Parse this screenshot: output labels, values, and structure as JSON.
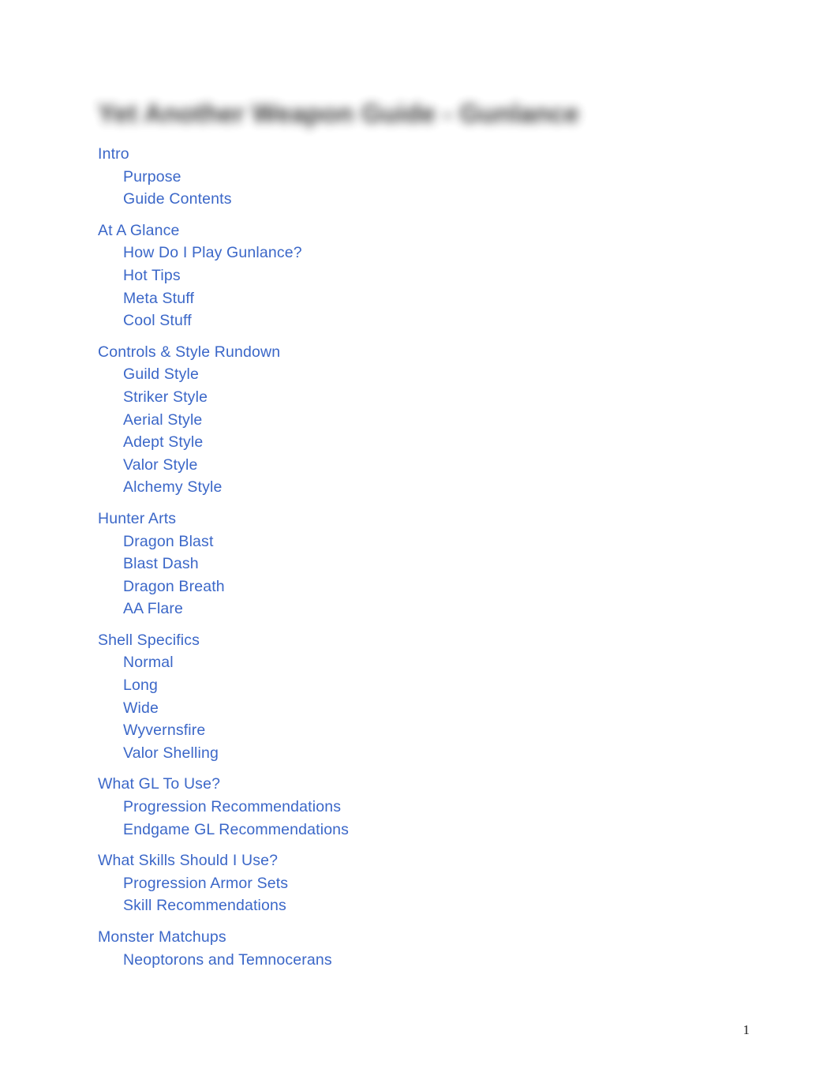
{
  "document": {
    "title": "Yet Another Weapon Guide - Gunlance",
    "title_redacted": true,
    "page_number": "1",
    "link_color": "#3b67c8",
    "background_color": "#ffffff",
    "title_color": "#2b2b2b"
  },
  "toc": {
    "sections": [
      {
        "heading": "Intro",
        "items": [
          "Purpose",
          "Guide Contents"
        ]
      },
      {
        "heading": "At A Glance",
        "items": [
          "How Do I Play Gunlance?",
          "Hot Tips",
          "Meta Stuff",
          "Cool Stuff"
        ]
      },
      {
        "heading": "Controls & Style Rundown",
        "items": [
          "Guild Style",
          "Striker Style",
          "Aerial Style",
          "Adept Style",
          "Valor Style",
          "Alchemy Style"
        ]
      },
      {
        "heading": "Hunter Arts",
        "items": [
          "Dragon Blast",
          "Blast Dash",
          "Dragon Breath",
          "AA Flare"
        ]
      },
      {
        "heading": "Shell Specifics",
        "items": [
          "Normal",
          "Long",
          "Wide",
          "Wyvernsfire",
          "Valor Shelling"
        ]
      },
      {
        "heading": "What GL To Use?",
        "items": [
          "Progression Recommendations",
          "Endgame GL Recommendations"
        ]
      },
      {
        "heading": "What Skills Should I Use?",
        "items": [
          "Progression Armor Sets",
          "Skill Recommendations"
        ]
      },
      {
        "heading": "Monster Matchups",
        "items": [
          "Neoptorons and Temnocerans"
        ]
      }
    ]
  }
}
